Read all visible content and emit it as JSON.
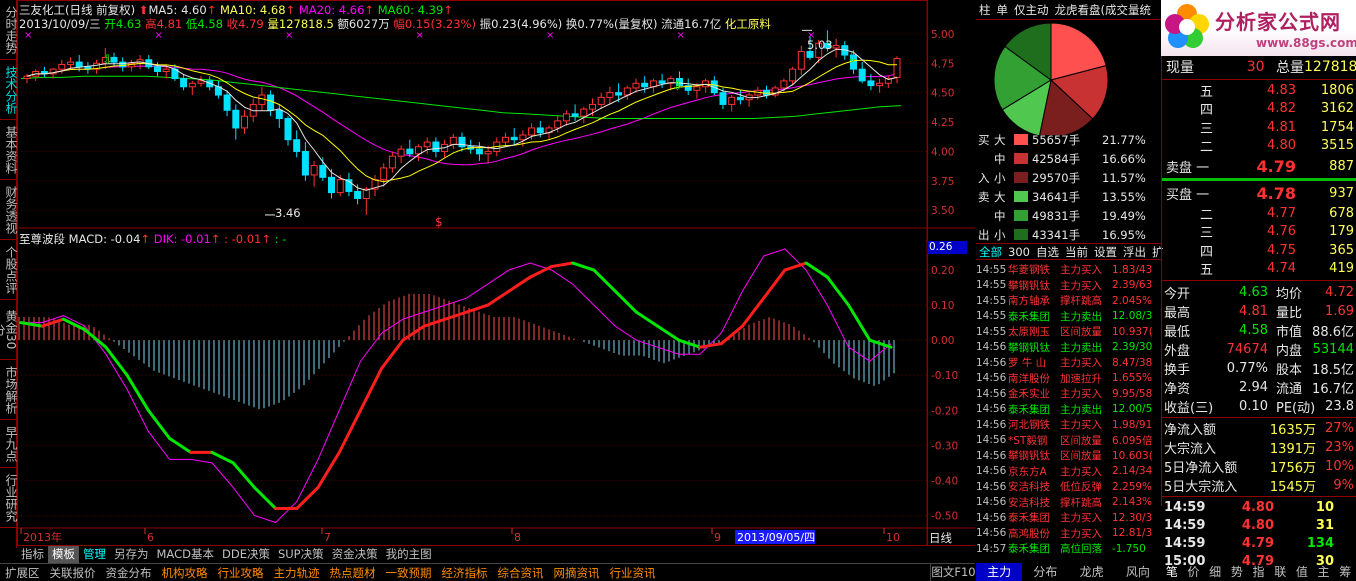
{
  "left_nav": [
    "分时走势",
    "技术分析",
    "基本资料",
    "财务透视",
    "个股点评",
    "黄金30分",
    "市场解析",
    "早九点",
    "行业研究"
  ],
  "header": {
    "stock": "三友化工(日线 前复权)",
    "ma5_label": "MA5: 4.60",
    "ma10_label": "MA10: 4.68",
    "ma20_label": "MA20: 4.66",
    "ma60_label": "MA60: 4.39",
    "date": "2013/10/09/三",
    "open": "开4.63",
    "high": "高4.81",
    "low": "低4.58",
    "close": "收4.79",
    "vol": "量127818.5",
    "amount": "额6027万",
    "change": "幅0.15(3.23%)",
    "amp": "振0.23(4.96%)",
    "turnover": "换0.77%(量复权)",
    "float": "流通16.7亿",
    "sector": "化工原料"
  },
  "price_axis": [
    "5.00",
    "4.75",
    "4.50",
    "4.25",
    "4.00",
    "3.75",
    "3.50"
  ],
  "price_marks": {
    "high_label": "5.03",
    "low_label": "3.46"
  },
  "macd_header": {
    "name": "至尊波段",
    "macd": "MACD: -0.04",
    "dik": "DIK: -0.01",
    "dea": ": -0.01",
    "extra": ": -"
  },
  "macd_axis": [
    "0.26",
    "0.20",
    "0.10",
    "0.00",
    "-0.10",
    "-0.20",
    "-0.30",
    "-0.40",
    "-0.50"
  ],
  "x_axis": {
    "labels": [
      "2013年",
      "6",
      "7",
      "8",
      "9",
      "2013/09/05/四",
      "10"
    ],
    "right_label": "日线"
  },
  "bottom_tabs": [
    "指标",
    "模板",
    "管理",
    "另存为",
    "MACD基本",
    "DDE决策",
    "SUP决策",
    "资金决策",
    "我的主图"
  ],
  "bottom_menu": [
    "扩展区",
    "关联报价",
    "资金分布",
    "机构攻略",
    "行业攻略",
    "主力轨迹",
    "热点题材",
    "一致预期",
    "经济指标",
    "综合资讯",
    "网摘资讯",
    "行业资讯"
  ],
  "right_top_tabs": [
    "柱",
    "单",
    "仅主动",
    "龙虎看盘(成交量统"
  ],
  "logo": {
    "text": "分析家公式网",
    "url": "www.88gs.com"
  },
  "pie": {
    "values": [
      21.77,
      16.66,
      16.95,
      13.55,
      19.49,
      15.58
    ]
  },
  "flow": [
    {
      "side": "买",
      "size": "大",
      "val": "55657手",
      "pct": "21.77%",
      "color": "#ff5050"
    },
    {
      "side": "",
      "size": "中",
      "val": "42584手",
      "pct": "16.66%",
      "color": "#c83232"
    },
    {
      "side": "入",
      "size": "小",
      "val": "29570手",
      "pct": "11.57%",
      "color": "#7a1e1e"
    },
    {
      "side": "卖",
      "size": "大",
      "val": "34641手",
      "pct": "13.55%",
      "color": "#50c850"
    },
    {
      "side": "",
      "size": "中",
      "val": "49831手",
      "pct": "19.49%",
      "color": "#32a032"
    },
    {
      "side": "出",
      "size": "小",
      "val": "43341手",
      "pct": "16.95%",
      "color": "#1e6e1e"
    }
  ],
  "market_filters": [
    "全部",
    "300",
    "自选",
    "当前",
    "设置",
    "浮出",
    "扩"
  ],
  "trades_list": [
    [
      "14:55",
      "华菱钢铁",
      "主力买入",
      "1.83/43"
    ],
    [
      "14:55",
      "攀钢钒钛",
      "主力买入",
      "2.39/63"
    ],
    [
      "14:55",
      "南方轴承",
      "撑杆跳高",
      "2.045%"
    ],
    [
      "14:55",
      "泰禾集团",
      "主力卖出",
      "12.08/3"
    ],
    [
      "14:55",
      "太原刚玉",
      "区间放量",
      "10.937("
    ],
    [
      "14:56",
      "攀钢钒钛",
      "主力卖出",
      "2.39/30"
    ],
    [
      "14:56",
      "罗 牛 山",
      "主力买入",
      "8.47/38"
    ],
    [
      "14:56",
      "南洋股份",
      "加速拉升",
      "1.655%"
    ],
    [
      "14:56",
      "金禾实业",
      "主力买入",
      "9.95/58"
    ],
    [
      "14:56",
      "泰禾集团",
      "主力卖出",
      "12.00/5"
    ],
    [
      "14:56",
      "河北钢铁",
      "主力买入",
      "1.98/91"
    ],
    [
      "14:56",
      "*ST毅钢",
      "区间放量",
      "6.095倍"
    ],
    [
      "14:56",
      "攀钢钒钛",
      "区间放量",
      "10.603("
    ],
    [
      "14:56",
      "京东方A",
      "主力买入",
      "2.14/34"
    ],
    [
      "14:56",
      "安洁科技",
      "低位反弹",
      "2.259%"
    ],
    [
      "14:56",
      "安洁科技",
      "撑杆跳高",
      "2.143%"
    ],
    [
      "14:56",
      "泰禾集团",
      "主力买入",
      "12.30/3"
    ],
    [
      "14:56",
      "高鸿股份",
      "主力买入",
      "12.81/3"
    ],
    [
      "14:57",
      "泰禾集团",
      "高位回落",
      "-1.750"
    ]
  ],
  "quote": {
    "now_label": "现量",
    "now": "30",
    "total_label": "总量",
    "total": "127818",
    "asks": [
      [
        "五",
        "4.83",
        "1806"
      ],
      [
        "四",
        "4.82",
        "3162"
      ],
      [
        "三",
        "4.81",
        "1754"
      ],
      [
        "二",
        "4.80",
        "3515"
      ],
      [
        "卖盘 一",
        "4.79",
        "887"
      ]
    ],
    "bids": [
      [
        "买盘 一",
        "4.78",
        "937"
      ],
      [
        "二",
        "4.77",
        "678"
      ],
      [
        "三",
        "4.76",
        "179"
      ],
      [
        "四",
        "4.75",
        "365"
      ],
      [
        "五",
        "4.74",
        "419"
      ]
    ],
    "stats": [
      [
        "今开",
        "4.63",
        "均价",
        "4.72"
      ],
      [
        "最高",
        "4.81",
        "量比",
        "1.69"
      ],
      [
        "最低",
        "4.58",
        "市值",
        "88.6亿"
      ],
      [
        "外盘",
        "74674",
        "内盘",
        "53144"
      ],
      [
        "换手",
        "0.77%",
        "股本",
        "18.5亿"
      ],
      [
        "净资",
        "2.94",
        "流通",
        "16.7亿"
      ],
      [
        "收益(三)",
        "0.10",
        "PE(动)",
        "23.8"
      ]
    ],
    "flows": [
      [
        "净流入额",
        "1635万",
        "27%"
      ],
      [
        "大宗流入",
        "1391万",
        "23%"
      ],
      [
        "5日净流入额",
        "1756万",
        "10%"
      ],
      [
        "5日大宗流入",
        "1545万",
        "9%"
      ]
    ],
    "ticks": [
      [
        "14:59",
        "4.80",
        "10"
      ],
      [
        "14:59",
        "4.80",
        "31"
      ],
      [
        "14:59",
        "4.79",
        "134"
      ],
      [
        "15:00",
        "4.79",
        "30"
      ]
    ]
  },
  "right_bottom_tabs": [
    "主力",
    "分布",
    "龙虎",
    "风向"
  ],
  "mini_tabs": [
    "笔",
    "价",
    "细",
    "势",
    "指",
    "联",
    "值",
    "主",
    "筹"
  ],
  "status_label": "图文F10",
  "chart_data": {
    "type": "candlestick",
    "price_range": [
      3.4,
      5.05
    ],
    "macd_range": [
      -0.53,
      0.28
    ],
    "candles": [
      [
        4.62,
        4.66,
        4.58,
        4.64
      ],
      [
        4.64,
        4.7,
        4.6,
        4.68
      ],
      [
        4.68,
        4.72,
        4.63,
        4.66
      ],
      [
        4.66,
        4.71,
        4.62,
        4.7
      ],
      [
        4.7,
        4.78,
        4.66,
        4.74
      ],
      [
        4.74,
        4.8,
        4.7,
        4.76
      ],
      [
        4.76,
        4.82,
        4.68,
        4.72
      ],
      [
        4.72,
        4.76,
        4.66,
        4.7
      ],
      [
        4.7,
        4.78,
        4.66,
        4.75
      ],
      [
        4.75,
        4.88,
        4.7,
        4.8
      ],
      [
        4.8,
        4.84,
        4.72,
        4.76
      ],
      [
        4.76,
        4.8,
        4.68,
        4.72
      ],
      [
        4.72,
        4.78,
        4.68,
        4.75
      ],
      [
        4.75,
        4.82,
        4.7,
        4.78
      ],
      [
        4.78,
        4.82,
        4.7,
        4.72
      ],
      [
        4.72,
        4.76,
        4.64,
        4.68
      ],
      [
        4.68,
        4.74,
        4.62,
        4.7
      ],
      [
        4.7,
        4.74,
        4.6,
        4.62
      ],
      [
        4.62,
        4.66,
        4.52,
        4.55
      ],
      [
        4.55,
        4.6,
        4.48,
        4.58
      ],
      [
        4.58,
        4.64,
        4.55,
        4.6
      ],
      [
        4.6,
        4.64,
        4.52,
        4.55
      ],
      [
        4.55,
        4.6,
        4.45,
        4.48
      ],
      [
        4.48,
        4.52,
        4.3,
        4.35
      ],
      [
        4.35,
        4.4,
        4.1,
        4.2
      ],
      [
        4.2,
        4.35,
        4.15,
        4.3
      ],
      [
        4.3,
        4.45,
        4.25,
        4.4
      ],
      [
        4.4,
        4.55,
        4.35,
        4.48
      ],
      [
        4.48,
        4.52,
        4.3,
        4.35
      ],
      [
        4.35,
        4.4,
        4.2,
        4.28
      ],
      [
        4.28,
        4.3,
        4.05,
        4.1
      ],
      [
        4.1,
        4.18,
        3.95,
        4.0
      ],
      [
        4.0,
        4.08,
        3.75,
        3.8
      ],
      [
        3.8,
        3.92,
        3.7,
        3.88
      ],
      [
        3.88,
        3.95,
        3.75,
        3.78
      ],
      [
        3.78,
        3.85,
        3.6,
        3.65
      ],
      [
        3.65,
        3.8,
        3.62,
        3.76
      ],
      [
        3.76,
        3.82,
        3.62,
        3.66
      ],
      [
        3.66,
        3.72,
        3.55,
        3.6
      ],
      [
        3.6,
        3.7,
        3.46,
        3.68
      ],
      [
        3.68,
        3.8,
        3.62,
        3.76
      ],
      [
        3.76,
        3.9,
        3.7,
        3.86
      ],
      [
        3.86,
        4.0,
        3.82,
        3.96
      ],
      [
        3.96,
        4.05,
        3.9,
        4.02
      ],
      [
        4.02,
        4.1,
        3.95,
        3.98
      ],
      [
        3.98,
        4.06,
        3.92,
        4.04
      ],
      [
        4.04,
        4.12,
        3.98,
        4.08
      ],
      [
        4.08,
        4.12,
        3.95,
        4.0
      ],
      [
        4.0,
        4.1,
        3.95,
        4.06
      ],
      [
        4.06,
        4.15,
        4.02,
        4.12
      ],
      [
        4.12,
        4.16,
        4.0,
        4.04
      ],
      [
        4.04,
        4.1,
        3.98,
        4.02
      ],
      [
        4.02,
        4.08,
        3.92,
        3.98
      ],
      [
        3.98,
        4.05,
        3.9,
        4.0
      ],
      [
        4.0,
        4.12,
        3.96,
        4.08
      ],
      [
        4.08,
        4.16,
        4.04,
        4.12
      ],
      [
        4.12,
        4.2,
        4.06,
        4.1
      ],
      [
        4.1,
        4.18,
        4.04,
        4.14
      ],
      [
        4.14,
        4.24,
        4.1,
        4.2
      ],
      [
        4.2,
        4.26,
        4.12,
        4.16
      ],
      [
        4.16,
        4.22,
        4.1,
        4.2
      ],
      [
        4.2,
        4.3,
        4.16,
        4.26
      ],
      [
        4.26,
        4.35,
        4.22,
        4.32
      ],
      [
        4.32,
        4.4,
        4.26,
        4.3
      ],
      [
        4.3,
        4.38,
        4.24,
        4.36
      ],
      [
        4.36,
        4.45,
        4.3,
        4.4
      ],
      [
        4.4,
        4.5,
        4.36,
        4.46
      ],
      [
        4.46,
        4.55,
        4.4,
        4.5
      ],
      [
        4.5,
        4.58,
        4.42,
        4.48
      ],
      [
        4.48,
        4.56,
        4.44,
        4.54
      ],
      [
        4.54,
        4.62,
        4.5,
        4.58
      ],
      [
        4.58,
        4.64,
        4.5,
        4.55
      ],
      [
        4.55,
        4.62,
        4.5,
        4.6
      ],
      [
        4.6,
        4.66,
        4.54,
        4.58
      ],
      [
        4.58,
        4.64,
        4.52,
        4.62
      ],
      [
        4.62,
        4.68,
        4.55,
        4.56
      ],
      [
        4.56,
        4.62,
        4.48,
        4.52
      ],
      [
        4.52,
        4.58,
        4.45,
        4.55
      ],
      [
        4.55,
        4.62,
        4.5,
        4.6
      ],
      [
        4.6,
        4.64,
        4.48,
        4.5
      ],
      [
        4.5,
        4.54,
        4.36,
        4.4
      ],
      [
        4.4,
        4.48,
        4.34,
        4.46
      ],
      [
        4.46,
        4.52,
        4.4,
        4.44
      ],
      [
        4.44,
        4.5,
        4.38,
        4.48
      ],
      [
        4.48,
        4.55,
        4.44,
        4.52
      ],
      [
        4.52,
        4.56,
        4.45,
        4.48
      ],
      [
        4.48,
        4.56,
        4.46,
        4.54
      ],
      [
        4.54,
        4.62,
        4.5,
        4.6
      ],
      [
        4.6,
        4.72,
        4.56,
        4.7
      ],
      [
        4.7,
        4.9,
        4.65,
        4.85
      ],
      [
        4.85,
        4.98,
        4.78,
        4.8
      ],
      [
        4.8,
        4.95,
        4.75,
        4.92
      ],
      [
        4.92,
        5.03,
        4.85,
        4.88
      ],
      [
        4.88,
        4.96,
        4.8,
        4.9
      ],
      [
        4.9,
        4.94,
        4.78,
        4.82
      ],
      [
        4.82,
        4.86,
        4.66,
        4.7
      ],
      [
        4.7,
        4.76,
        4.58,
        4.6
      ],
      [
        4.6,
        4.66,
        4.52,
        4.56
      ],
      [
        4.56,
        4.62,
        4.5,
        4.58
      ],
      [
        4.58,
        4.64,
        4.54,
        4.62
      ],
      [
        4.63,
        4.81,
        4.58,
        4.79
      ]
    ],
    "ma_names": [
      "MA5",
      "MA10",
      "MA20",
      "MA60"
    ],
    "ma_colors": [
      "#e6e6e6",
      "#ffff00",
      "#ff00ff",
      "#00e600"
    ],
    "ma60": [
      4.62,
      4.63,
      4.63,
      4.64,
      4.64,
      4.64,
      4.64,
      4.63,
      4.62,
      4.61,
      4.59,
      4.57,
      4.55,
      4.53,
      4.51,
      4.49,
      4.47,
      4.45,
      4.43,
      4.41,
      4.39,
      4.37,
      4.35,
      4.33,
      4.32,
      4.31,
      4.3,
      4.29,
      4.28,
      4.28,
      4.28,
      4.28,
      4.28,
      4.28,
      4.28,
      4.28,
      4.29,
      4.3,
      4.32,
      4.34,
      4.36,
      4.38,
      4.39
    ],
    "macd_line": [
      0.05,
      0.04,
      0.06,
      0.03,
      -0.02,
      -0.1,
      -0.2,
      -0.28,
      -0.32,
      -0.32,
      -0.35,
      -0.42,
      -0.48,
      -0.48,
      -0.42,
      -0.32,
      -0.2,
      -0.08,
      0.0,
      0.04,
      0.06,
      0.08,
      0.1,
      0.14,
      0.18,
      0.21,
      0.22,
      0.2,
      0.14,
      0.08,
      0.04,
      0.0,
      -0.02,
      -0.01,
      0.04,
      0.12,
      0.2,
      0.22,
      0.18,
      0.1,
      0.0,
      -0.02
    ],
    "dik_line": [
      0.05,
      0.05,
      0.07,
      0.04,
      -0.04,
      -0.14,
      -0.26,
      -0.34,
      -0.34,
      -0.35,
      -0.42,
      -0.5,
      -0.52,
      -0.46,
      -0.34,
      -0.2,
      -0.06,
      0.02,
      0.06,
      0.08,
      0.1,
      0.12,
      0.16,
      0.2,
      0.22,
      0.2,
      0.16,
      0.1,
      0.04,
      0.0,
      -0.02,
      -0.04,
      -0.04,
      0.02,
      0.14,
      0.24,
      0.26,
      0.2,
      0.1,
      -0.02,
      -0.06,
      -0.01
    ],
    "hist": [
      0.03,
      0.03,
      0.02,
      0.02,
      0.0,
      -0.02,
      -0.04,
      -0.05,
      -0.06,
      -0.07,
      -0.08,
      -0.09,
      -0.08,
      -0.06,
      -0.03,
      0.0,
      0.03,
      0.05,
      0.06,
      0.06,
      0.05,
      0.04,
      0.03,
      0.03,
      0.02,
      0.01,
      0.0,
      -0.01,
      -0.02,
      -0.02,
      -0.03,
      -0.02,
      -0.01,
      0.0,
      0.02,
      0.03,
      0.02,
      0.0,
      -0.03,
      -0.05,
      -0.06,
      -0.04
    ]
  }
}
